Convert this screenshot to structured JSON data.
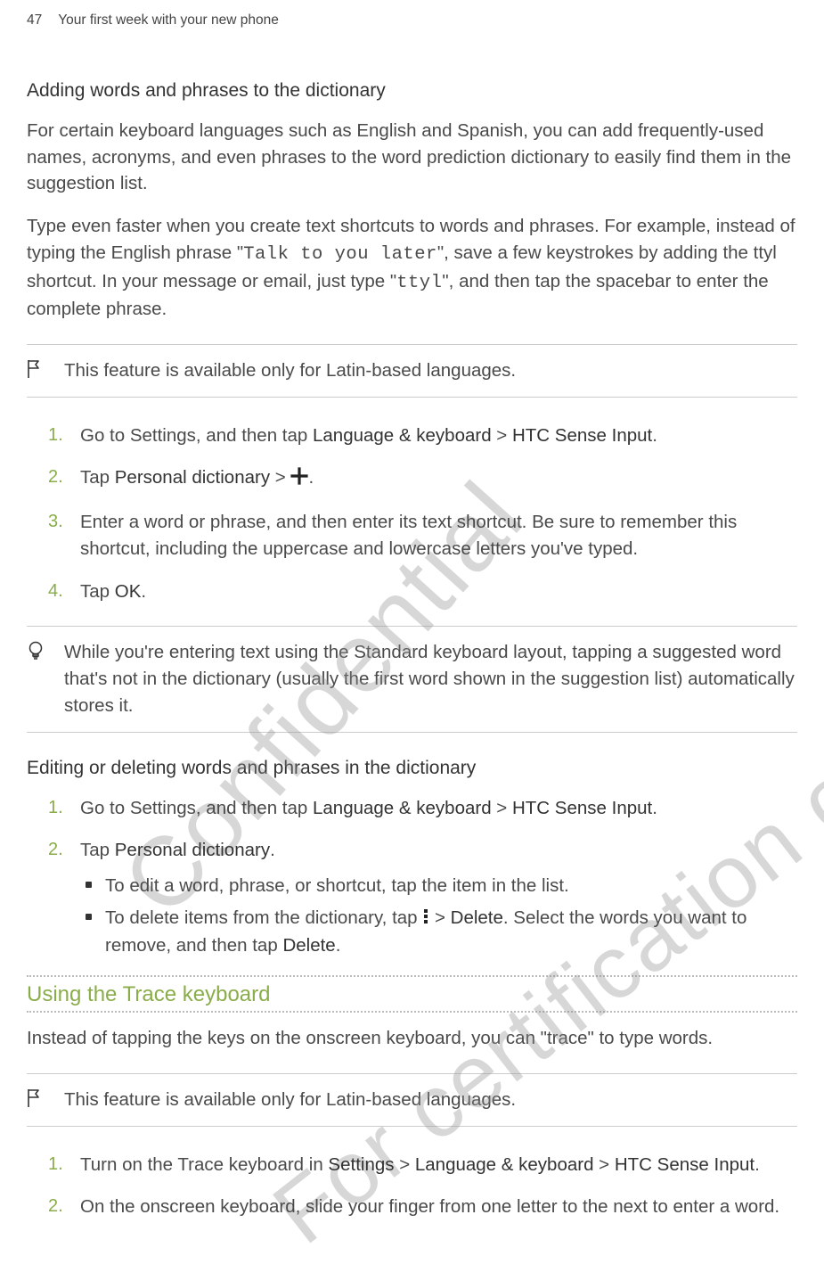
{
  "header": {
    "pageNum": "47",
    "breadcrumb": "Your first week with your new phone"
  },
  "watermarks": {
    "wm1": "Confidential",
    "wm2": "For certification on"
  },
  "sec1": {
    "title": "Adding words and phrases to the dictionary",
    "p1": "For certain keyboard languages such as English and Spanish, you can add frequently-used names, acronyms, and even phrases to the word prediction dictionary to easily find them in the suggestion list.",
    "p2a": "Type even faster when you create text shortcuts to words and phrases. For example, instead of typing the English phrase \"",
    "p2code1": "Talk to you later",
    "p2b": "\", save a few keystrokes by adding the ttyl shortcut. In your message or email, just type \"",
    "p2code2": "ttyl",
    "p2c": "\", and then tap the spacebar to enter the complete phrase.",
    "note1": "This feature is available only for Latin-based languages.",
    "step1a": "Go to Settings, and then tap ",
    "step1b": "Language & keyboard",
    "step1c": " > ",
    "step1d": "HTC Sense Input",
    "step1e": ".",
    "step2a": "Tap ",
    "step2b": "Personal dictionary",
    "step2c": " > ",
    "step2d": ".",
    "step3": "Enter a word or phrase, and then enter its text shortcut. Be sure to remember this shortcut, including the uppercase and lowercase letters you've typed.",
    "step4a": "Tap ",
    "step4b": "OK",
    "step4c": ".",
    "tip": "While you're entering text using the Standard keyboard layout, tapping a suggested word that's not in the dictionary (usually the first word shown in the suggestion list) automatically stores it."
  },
  "sec2": {
    "title": "Editing or deleting words and phrases in the dictionary",
    "step1a": "Go to Settings, and then tap ",
    "step1b": "Language & keyboard",
    "step1c": " > ",
    "step1d": "HTC Sense Input",
    "step1e": ".",
    "step2a": "Tap ",
    "step2b": "Personal dictionary",
    "step2c": ".",
    "b1": "To edit a word, phrase, or shortcut, tap the item in the list.",
    "b2a": "To delete items from the dictionary, tap ",
    "b2b": " > ",
    "b2c": "Delete",
    "b2d": ". Select the words you want to remove, and then tap ",
    "b2e": "Delete",
    "b2f": "."
  },
  "sec3": {
    "title": "Using the Trace keyboard",
    "p1": "Instead of tapping the keys on the onscreen keyboard, you can \"trace\" to type words.",
    "note": "This feature is available only for Latin-based languages.",
    "step1a": "Turn on the Trace keyboard in ",
    "step1b": "Settings",
    "step1c": " > ",
    "step1d": "Language & keyboard",
    "step1e": " > ",
    "step1f": "HTC Sense Input",
    "step1g": ".",
    "step2": "On the onscreen keyboard, slide your finger from one letter to the next to enter a word."
  }
}
